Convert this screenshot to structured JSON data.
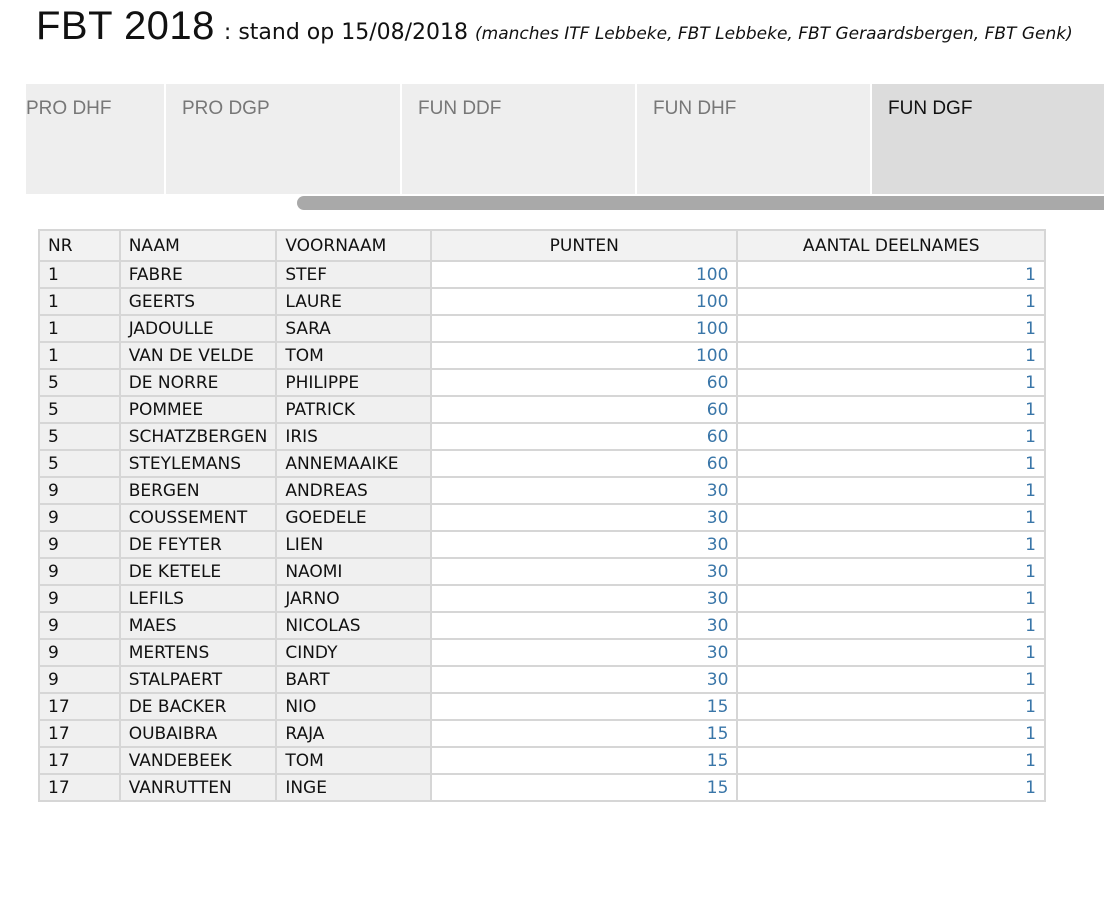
{
  "header": {
    "title": "FBT 2018",
    "subtitle": " : stand op 15/08/2018 ",
    "subtitle_note": "(manches ITF Lebbeke, FBT Lebbeke, FBT Geraardsbergen, FBT Genk)"
  },
  "tabs": [
    {
      "label": "PRO DHF",
      "active": false
    },
    {
      "label": "PRO DGP",
      "active": false
    },
    {
      "label": "FUN DDF",
      "active": false
    },
    {
      "label": "FUN DHF",
      "active": false
    },
    {
      "label": "FUN DGF",
      "active": true
    }
  ],
  "table": {
    "columns": [
      "NR",
      "NAAM",
      "VOORNAAM",
      "PUNTEN",
      "AANTAL DEELNAMES"
    ],
    "rows": [
      [
        "1",
        "FABRE",
        "STEF",
        "100",
        "1"
      ],
      [
        "1",
        "GEERTS",
        "LAURE",
        "100",
        "1"
      ],
      [
        "1",
        "JADOULLE",
        "SARA",
        "100",
        "1"
      ],
      [
        "1",
        "VAN DE VELDE",
        "TOM",
        "100",
        "1"
      ],
      [
        "5",
        "DE NORRE",
        "PHILIPPE",
        "60",
        "1"
      ],
      [
        "5",
        "POMMEE",
        "PATRICK",
        "60",
        "1"
      ],
      [
        "5",
        "SCHATZBERGEN",
        "IRIS",
        "60",
        "1"
      ],
      [
        "5",
        "STEYLEMANS",
        "ANNEMAAIKE",
        "60",
        "1"
      ],
      [
        "9",
        "BERGEN",
        "ANDREAS",
        "30",
        "1"
      ],
      [
        "9",
        "COUSSEMENT",
        "GOEDELE",
        "30",
        "1"
      ],
      [
        "9",
        "DE FEYTER",
        "LIEN",
        "30",
        "1"
      ],
      [
        "9",
        "DE KETELE",
        "NAOMI",
        "30",
        "1"
      ],
      [
        "9",
        "LEFILS",
        "JARNO",
        "30",
        "1"
      ],
      [
        "9",
        "MAES",
        "NICOLAS",
        "30",
        "1"
      ],
      [
        "9",
        "MERTENS",
        "CINDY",
        "30",
        "1"
      ],
      [
        "9",
        "STALPAERT",
        "BART",
        "30",
        "1"
      ],
      [
        "17",
        "DE BACKER",
        "NIO",
        "15",
        "1"
      ],
      [
        "17",
        "OUBAIBRA",
        "RAJA",
        "15",
        "1"
      ],
      [
        "17",
        "VANDEBEEK",
        "TOM",
        "15",
        "1"
      ],
      [
        "17",
        "VANRUTTEN",
        "INGE",
        "15",
        "1"
      ]
    ]
  },
  "colors": {
    "number_text": "#3a76a8",
    "active_tab": "#dcdcdc",
    "inactive_tab": "#eeeeee"
  }
}
